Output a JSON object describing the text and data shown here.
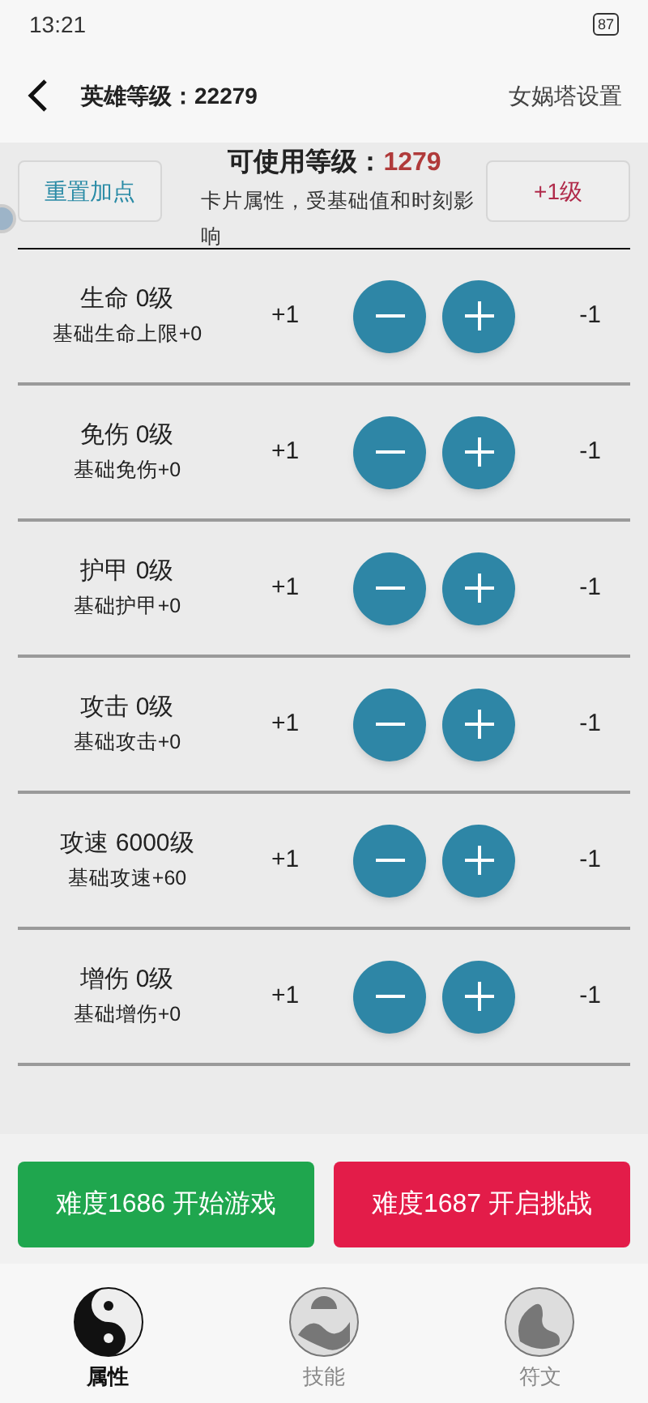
{
  "status_bar": {
    "time": "13:21",
    "battery": "87"
  },
  "header": {
    "title": "英雄等级：22279",
    "action": "女娲塔设置"
  },
  "summary": {
    "reset_button": "重置加点",
    "available_label": "可使用等级：",
    "available_value": "1279",
    "description": "卡片属性，受基础值和时刻影响",
    "level_button": "+1级"
  },
  "stats": [
    {
      "name": "生命 0级",
      "base": "基础生命上限+0",
      "plus": "+1",
      "minus": "-1"
    },
    {
      "name": "免伤 0级",
      "base": "基础免伤+0",
      "plus": "+1",
      "minus": "-1"
    },
    {
      "name": "护甲 0级",
      "base": "基础护甲+0",
      "plus": "+1",
      "minus": "-1"
    },
    {
      "name": "攻击 0级",
      "base": "基础攻击+0",
      "plus": "+1",
      "minus": "-1"
    },
    {
      "name": "攻速 6000级",
      "base": "基础攻速+60",
      "plus": "+1",
      "minus": "-1"
    },
    {
      "name": "增伤 0级",
      "base": "基础增伤+0",
      "plus": "+1",
      "minus": "-1"
    }
  ],
  "actions": [
    {
      "label": "难度1686 开始游戏",
      "kind": "start"
    },
    {
      "label": "难度1687 开启挑战",
      "kind": "challenge"
    }
  ],
  "tabs": [
    {
      "label": "属性",
      "selected": true
    },
    {
      "label": "技能",
      "selected": false
    },
    {
      "label": "符文",
      "selected": false
    }
  ]
}
